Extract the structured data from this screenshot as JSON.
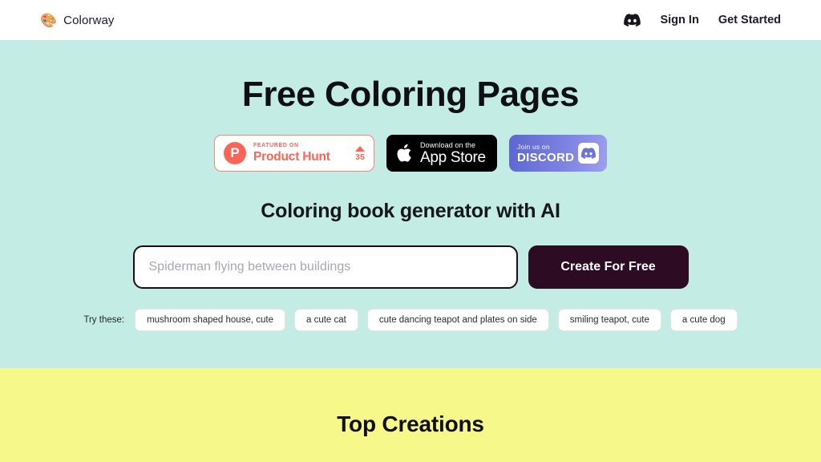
{
  "header": {
    "brand_icon": "palette-icon",
    "brand_name": "Colorway",
    "discord_icon": "discord-icon",
    "sign_in_label": "Sign In",
    "get_started_label": "Get Started"
  },
  "hero": {
    "title": "Free Coloring Pages",
    "subtitle": "Coloring book generator with AI",
    "badges": {
      "product_hunt": {
        "featured_label": "FEATURED ON",
        "name": "Product Hunt",
        "logo_letter": "P",
        "upvote_icon": "upvote-triangle-icon",
        "vote_count": "35"
      },
      "app_store": {
        "apple_icon": "apple-logo-icon",
        "small_label": "Download on the",
        "big_label": "App Store"
      },
      "discord": {
        "small_label": "Join us on",
        "big_label": "DISCORD",
        "logo_icon": "discord-logo-icon"
      }
    },
    "prompt": {
      "placeholder": "Spiderman flying between buildings",
      "value": ""
    },
    "create_button_label": "Create For Free",
    "try_these": {
      "label": "Try these:",
      "suggestions": [
        "mushroom shaped house, cute",
        "a cute cat",
        "cute dancing teapot and plates on side",
        "smiling teapot, cute",
        "a cute dog"
      ]
    }
  },
  "creations": {
    "title": "Top Creations"
  },
  "colors": {
    "hero_background": "#c2ece4",
    "creations_background": "#f7f88a",
    "header_background": "#ffffff",
    "button_dark": "#2d0b22",
    "product_hunt_accent": "#fa6557",
    "discord_gradient_start": "#5b66cf",
    "discord_gradient_end": "#9ba0ee"
  }
}
